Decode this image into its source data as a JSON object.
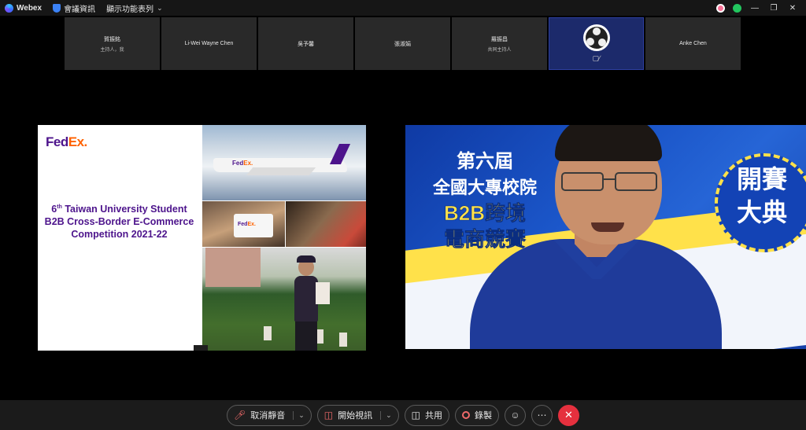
{
  "titlebar": {
    "app_name": "Webex",
    "meeting_info": "會議資訊",
    "menu": "顯示功能表列"
  },
  "participants": [
    {
      "name": "賀振銘",
      "role": "主持人，我"
    },
    {
      "name": "Li-Wei Wayne Chen",
      "role": ""
    },
    {
      "name": "吳予馨",
      "role": ""
    },
    {
      "name": "張淑娟",
      "role": ""
    },
    {
      "name": "羅振昌",
      "role": "共同主持人"
    },
    {
      "name": "",
      "role": ""
    },
    {
      "name": "Anke Chen",
      "role": ""
    }
  ],
  "slide": {
    "logo_fed": "Fed",
    "logo_ex": "Ex.",
    "title_prefix": "6",
    "title_sup": "th",
    "title_line1": " Taiwan University Student",
    "title_line2": "B2B Cross-Border E-Commerce",
    "title_line3": "Competition 2021-22"
  },
  "video": {
    "line1": "第六屆",
    "line2": "全國大專校院",
    "line3": "B2B跨境",
    "line4": "電商競賽",
    "badge_line1": "開賽",
    "badge_line2": "大典"
  },
  "toolbar": {
    "mute_label": "取消靜音",
    "video_label": "開始視訊",
    "share_label": "共用",
    "record_label": "錄製"
  },
  "colors": {
    "fedex_purple": "#4d148c",
    "fedex_orange": "#ff6200",
    "end_call": "#e5303e"
  }
}
